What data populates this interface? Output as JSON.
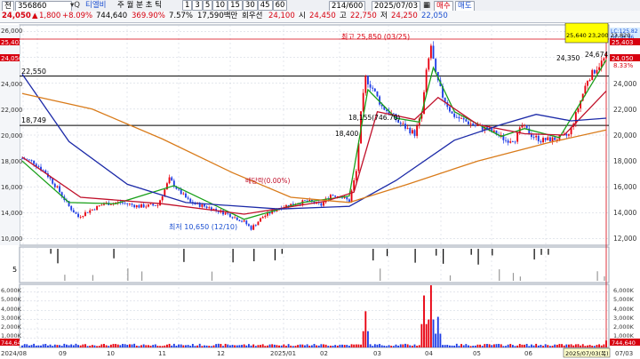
{
  "toolbar": {
    "market": "전",
    "code": "356860",
    "name": "티엘비",
    "periods": [
      "주",
      "월",
      "분",
      "초",
      "틱"
    ],
    "minute_values": [
      "1",
      "3",
      "5",
      "10",
      "15",
      "30",
      "45",
      "60"
    ],
    "count": "214",
    "count_total": "600",
    "date": "2025/07/03",
    "btn_d": "매수",
    "btn_e": "매도"
  },
  "quote": {
    "price": "24,050",
    "arrow": "▲",
    "change": "1,800",
    "change_pct": "+8.09%",
    "volume": "744,640",
    "vol_ratio": "369.90%",
    "turnover": "7.57%",
    "amount": "17,590백만",
    "badge": "회우선",
    "open_label": "시",
    "open": "24,100",
    "high_label": "고",
    "high": "24,450",
    "low_label": "저",
    "low": "22,750",
    "close_label": "",
    "close": "24,250",
    "last": "22,050"
  },
  "colors": {
    "up": "#e8000f",
    "down": "#1f3ee6",
    "ma5": "#1aa01a",
    "ma20": "#c0102a",
    "ma60": "#1c2aa8",
    "ma120": "#d97b1a",
    "hline": "#000000",
    "grid": "#c8cfdb"
  },
  "price_axis": {
    "ticks": [
      "26,000",
      "24,000",
      "22,000",
      "20,000",
      "18,000",
      "16,000",
      "14,000",
      "12,000",
      "10,000"
    ],
    "tags": [
      "25,403",
      "24,050"
    ],
    "right_tags": [
      "25,403",
      "24,050",
      "8.33%"
    ],
    "hl_tag": "LC:125.82\nHC:-6.96"
  },
  "annotations": {
    "high": "최고 25,850 (03/25)",
    "low": "최저 10,650 (12/10)",
    "dividend": "배당락(0.00%)",
    "level1": "22,550",
    "level2": "18,749",
    "mid": "18,155(746.70)",
    "mid2": "18,400",
    "peak1": "24,350",
    "peak2": "24,674",
    "box": "25,640  23,200  23,820"
  },
  "signal_axis": {
    "label": "5"
  },
  "volume_axis": {
    "ticks": [
      "6,000K",
      "5,000K",
      "4,000K",
      "3,000K",
      "2,000K",
      "1,000K"
    ],
    "tag": "744,640"
  },
  "x_axis": {
    "labels": [
      "2024/08",
      "09",
      "10",
      "11",
      "12",
      "2025/01",
      "02",
      "03",
      "04",
      "05",
      "06",
      "07/03"
    ],
    "cursor_label": "2025/07/03(목)"
  },
  "chart_data": {
    "type": "candlestick",
    "x_range": [
      "2024/08",
      "2025/07/03"
    ],
    "ylim": [
      9500,
      26500
    ],
    "volume_ylim": [
      0,
      6800000
    ],
    "price_path": [
      [
        0,
        16200
      ],
      [
        5,
        15900
      ],
      [
        10,
        15100
      ],
      [
        15,
        13900
      ],
      [
        20,
        12500
      ],
      [
        24,
        11700
      ],
      [
        28,
        12100
      ],
      [
        35,
        12700
      ],
      [
        42,
        12800
      ],
      [
        50,
        12500
      ],
      [
        58,
        12600
      ],
      [
        63,
        14600
      ],
      [
        67,
        13700
      ],
      [
        72,
        12800
      ],
      [
        80,
        12400
      ],
      [
        88,
        11900
      ],
      [
        95,
        11300
      ],
      [
        98,
        10800
      ],
      [
        103,
        11700
      ],
      [
        110,
        12400
      ],
      [
        116,
        12700
      ],
      [
        122,
        12900
      ],
      [
        128,
        12600
      ],
      [
        132,
        13400
      ],
      [
        136,
        13300
      ],
      [
        140,
        12900
      ],
      [
        143,
        15200
      ],
      [
        145,
        19600
      ],
      [
        147,
        22400
      ],
      [
        150,
        21600
      ],
      [
        154,
        20200
      ],
      [
        158,
        19600
      ],
      [
        161,
        19000
      ],
      [
        164,
        18600
      ],
      [
        168,
        18100
      ],
      [
        171,
        19600
      ],
      [
        173,
        22800
      ],
      [
        175,
        24900
      ],
      [
        177,
        22600
      ],
      [
        180,
        21000
      ],
      [
        184,
        19600
      ],
      [
        188,
        19200
      ],
      [
        193,
        18800
      ],
      [
        198,
        18500
      ],
      [
        203,
        18100
      ],
      [
        207,
        17600
      ],
      [
        211,
        17700
      ],
      [
        214,
        18700
      ],
      [
        218,
        18000
      ],
      [
        222,
        17600
      ],
      [
        228,
        17700
      ],
      [
        234,
        18000
      ],
      [
        238,
        20100
      ],
      [
        242,
        22300
      ],
      [
        246,
        23200
      ],
      [
        250,
        24050
      ]
    ],
    "ma_paths": {
      "ma5": [
        [
          0,
          16000
        ],
        [
          20,
          12800
        ],
        [
          40,
          12700
        ],
        [
          65,
          14100
        ],
        [
          95,
          11500
        ],
        [
          120,
          12800
        ],
        [
          140,
          13300
        ],
        [
          148,
          21500
        ],
        [
          160,
          19300
        ],
        [
          170,
          19000
        ],
        [
          176,
          23200
        ],
        [
          185,
          19800
        ],
        [
          205,
          17900
        ],
        [
          215,
          18500
        ],
        [
          230,
          17800
        ],
        [
          250,
          23800
        ]
      ],
      "ma20": [
        [
          0,
          16300
        ],
        [
          25,
          13200
        ],
        [
          60,
          12700
        ],
        [
          95,
          11900
        ],
        [
          130,
          12900
        ],
        [
          142,
          13600
        ],
        [
          152,
          19800
        ],
        [
          168,
          19200
        ],
        [
          178,
          20900
        ],
        [
          195,
          18800
        ],
        [
          215,
          18100
        ],
        [
          232,
          18000
        ],
        [
          250,
          21400
        ]
      ],
      "ma60": [
        [
          0,
          22700
        ],
        [
          20,
          17500
        ],
        [
          45,
          14200
        ],
        [
          70,
          12800
        ],
        [
          110,
          12300
        ],
        [
          140,
          12500
        ],
        [
          160,
          14500
        ],
        [
          185,
          17600
        ],
        [
          205,
          18800
        ],
        [
          220,
          19600
        ],
        [
          235,
          19100
        ],
        [
          250,
          19300
        ]
      ],
      "ma120": [
        [
          0,
          21200
        ],
        [
          30,
          20000
        ],
        [
          60,
          17700
        ],
        [
          90,
          15100
        ],
        [
          115,
          13200
        ],
        [
          140,
          12800
        ],
        [
          165,
          14200
        ],
        [
          195,
          16000
        ],
        [
          225,
          17400
        ],
        [
          250,
          18400
        ]
      ]
    },
    "volume_peaks": [
      [
        147,
        3900000
      ],
      [
        172,
        5600000
      ],
      [
        175,
        6700000
      ],
      [
        178,
        3300000
      ],
      [
        250,
        744640
      ]
    ]
  }
}
